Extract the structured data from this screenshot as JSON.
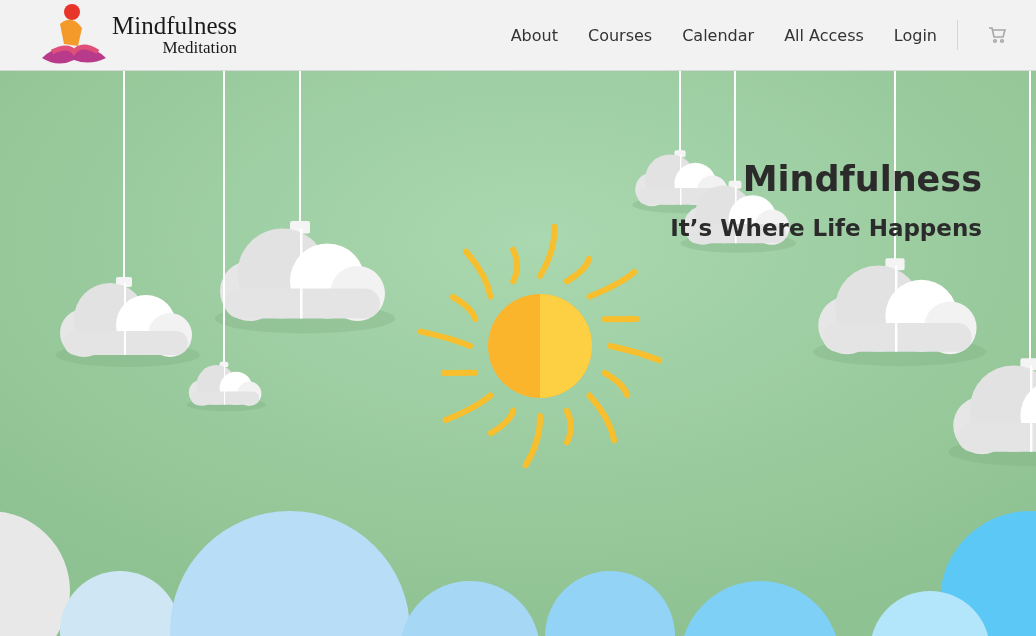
{
  "logo": {
    "title": "Mindfulness",
    "subtitle": "Meditation"
  },
  "nav": [
    {
      "label": "About"
    },
    {
      "label": "Courses"
    },
    {
      "label": "Calendar"
    },
    {
      "label": "All Access"
    },
    {
      "label": "Login"
    }
  ],
  "hero": {
    "title": "Mindfulness",
    "tagline": "It’s Where Life Happens"
  }
}
